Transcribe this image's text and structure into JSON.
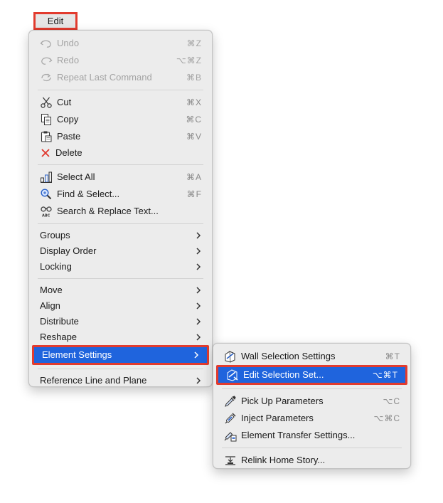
{
  "menubar": {
    "title": "Edit"
  },
  "main_menu": {
    "undo": {
      "label": "Undo",
      "shortcut": "⌘Z"
    },
    "redo": {
      "label": "Redo",
      "shortcut": "⌥⌘Z"
    },
    "repeat": {
      "label": "Repeat Last Command",
      "shortcut": "⌘B"
    },
    "cut": {
      "label": "Cut",
      "shortcut": "⌘X"
    },
    "copy": {
      "label": "Copy",
      "shortcut": "⌘C"
    },
    "paste": {
      "label": "Paste",
      "shortcut": "⌘V"
    },
    "delete": {
      "label": "Delete"
    },
    "select_all": {
      "label": "Select All",
      "shortcut": "⌘A"
    },
    "find_select": {
      "label": "Find & Select...",
      "shortcut": "⌘F"
    },
    "search_replace": {
      "label": "Search & Replace Text..."
    },
    "groups": {
      "label": "Groups"
    },
    "display_order": {
      "label": "Display Order"
    },
    "locking": {
      "label": "Locking"
    },
    "move": {
      "label": "Move"
    },
    "align": {
      "label": "Align"
    },
    "distribute": {
      "label": "Distribute"
    },
    "reshape": {
      "label": "Reshape"
    },
    "element_settings": {
      "label": "Element Settings"
    },
    "reference_line": {
      "label": "Reference Line and Plane"
    }
  },
  "sub_menu": {
    "wall_selection": {
      "label": "Wall Selection Settings",
      "shortcut": "⌘T"
    },
    "edit_selection_set": {
      "label": "Edit Selection Set...",
      "shortcut": "⌥⌘T"
    },
    "pick_up": {
      "label": "Pick Up Parameters",
      "shortcut": "⌥C"
    },
    "inject": {
      "label": "Inject Parameters",
      "shortcut": "⌥⌘C"
    },
    "transfer": {
      "label": "Element Transfer Settings..."
    },
    "relink": {
      "label": "Relink Home Story..."
    }
  },
  "colors": {
    "highlight": "#1f64dd",
    "annotation": "#e23b2e",
    "delete_icon": "#e0362b"
  }
}
